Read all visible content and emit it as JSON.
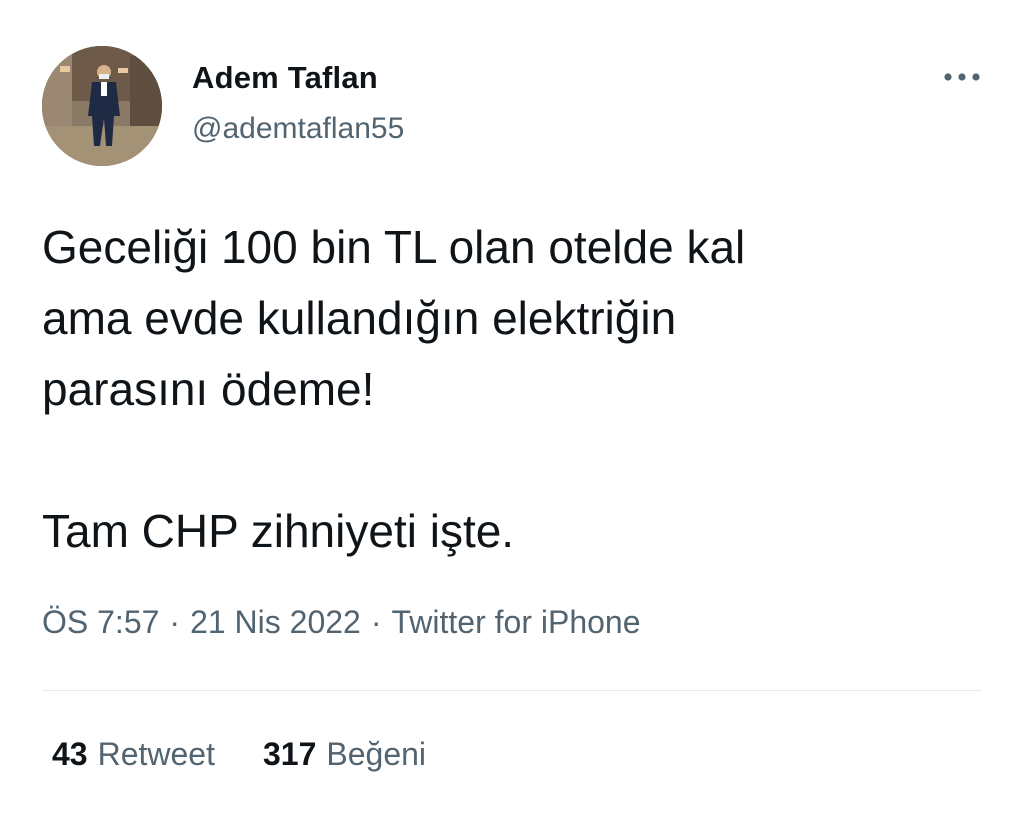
{
  "author": {
    "name": "Adem Taflan",
    "handle": "@ademtaflan55"
  },
  "more_icon": "more-horizontal-icon",
  "tweet": {
    "lines": [
      "Geceliği 100 bin TL olan otelde kal",
      "ama evde kullandığın elektriğin",
      "parasını ödeme!",
      "Tam CHP zihniyeti işte."
    ]
  },
  "meta": {
    "time": "ÖS 7:57",
    "separator": "·",
    "date": "21 Nis 2022",
    "source": "Twitter for iPhone"
  },
  "stats": {
    "retweets_count": "43",
    "retweets_label": "Retweet",
    "likes_count": "317",
    "likes_label": "Beğeni"
  },
  "colors": {
    "text_primary": "#0f1419",
    "text_secondary": "#536471",
    "divider": "#e6e9eb"
  }
}
